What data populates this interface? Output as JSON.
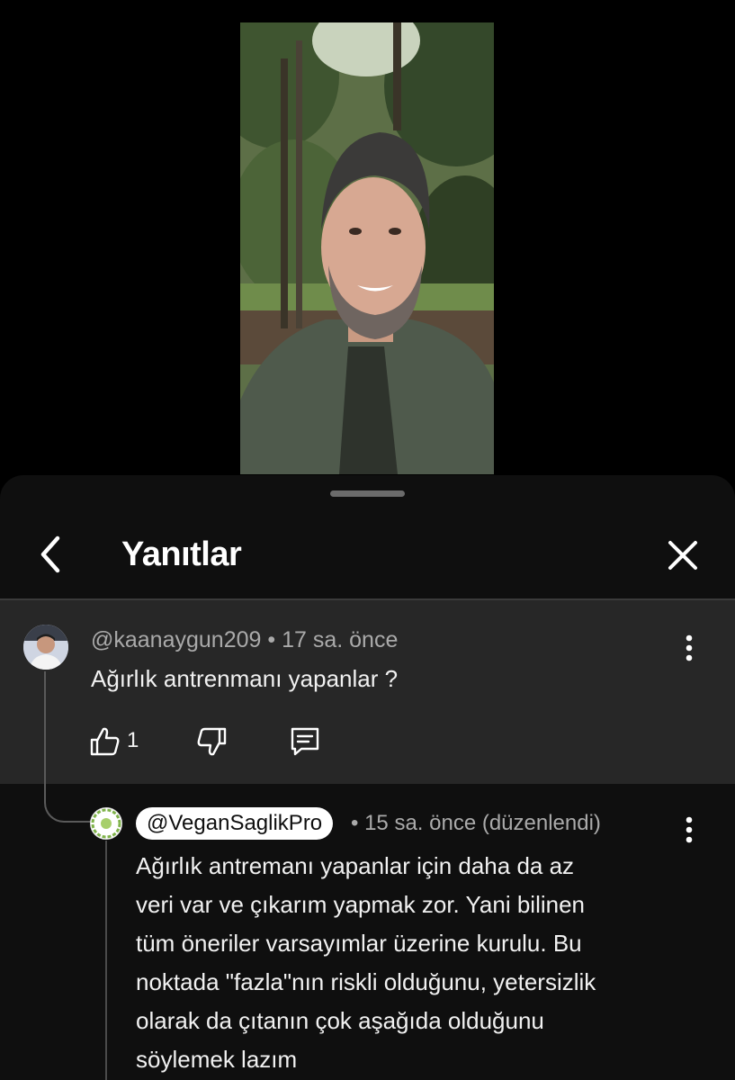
{
  "sheet": {
    "title": "Yanıtlar"
  },
  "parent_comment": {
    "author": "@kaanaygun209",
    "separator": "•",
    "time": "17 sa. önce",
    "text": "Ağırlık antrenmanı yapanlar ?",
    "like_count": "1"
  },
  "reply": {
    "author": "@VeganSaglikPro",
    "separator": "•",
    "time": "15 sa. önce (düzenlendi)",
    "lines": [
      "Ağırlık antremanı yapanlar için daha da az",
      "veri var ve çıkarım yapmak zor. Yani bilinen",
      "tüm öneriler varsayımlar üzerine kurulu. Bu",
      "noktada \"fazla\"nın riskli olduğunu, yetersizlik",
      "olarak da çıtanın çok aşağıda olduğunu",
      "söylemek lazım"
    ]
  },
  "icons": [
    "back-arrow-icon",
    "close-icon",
    "more-vert-icon",
    "thumbs-up-icon",
    "thumbs-down-icon",
    "reply-comment-icon"
  ],
  "colors": {
    "background": "#000000",
    "sheet": "#0f0f0f",
    "parent_highlight": "#272727",
    "secondary_text": "#aaaaaa",
    "primary_text": "#f1f1f1"
  }
}
